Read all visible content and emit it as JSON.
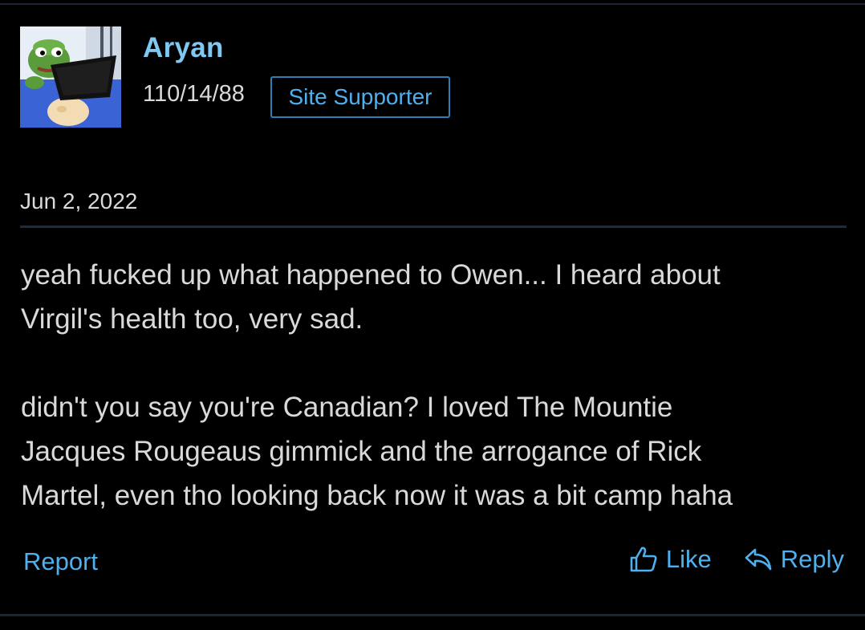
{
  "post": {
    "author": {
      "name": "Aryan",
      "stats": "110/14/88",
      "badge": "Site Supporter"
    },
    "date": "Jun 2, 2022",
    "body": [
      "yeah fucked up what happened to Owen... I heard about\nVirgil's health too, very sad.",
      "didn't you say you're Canadian? I loved The Mountie\nJacques Rougeaus gimmick and the arrogance of Rick\nMartel, even tho looking back now it was a bit camp haha"
    ],
    "actions": {
      "report": "Report",
      "like": "Like",
      "reply": "Reply"
    }
  },
  "icons": {
    "like": "thumbs-up-icon",
    "reply": "reply-arrow-icon"
  },
  "colors": {
    "background": "#000000",
    "accent": "#4fb0f0",
    "username": "#7ec8f2",
    "text": "#d9d9d9",
    "divider": "#1c2b3d"
  }
}
